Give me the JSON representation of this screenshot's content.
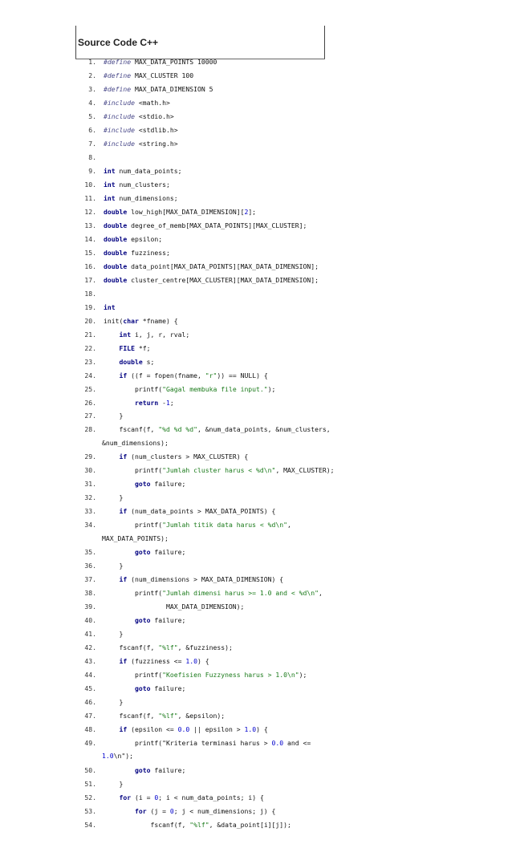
{
  "document": {
    "title": "Source Code C++",
    "lines": [
      {
        "n": "1",
        "t": "#define MAX_DATA_POINTS 10000"
      },
      {
        "n": "2",
        "t": "#define MAX_CLUSTER 100"
      },
      {
        "n": "3",
        "t": "#define MAX_DATA_DIMENSION 5"
      },
      {
        "n": "4",
        "t": "#include <math.h>"
      },
      {
        "n": "5",
        "t": "#include <stdio.h>"
      },
      {
        "n": "6",
        "t": "#include <stdlib.h>"
      },
      {
        "n": "7",
        "t": "#include <string.h>"
      },
      {
        "n": "8",
        "t": ""
      },
      {
        "n": "9",
        "t": "int num_data_points;"
      },
      {
        "n": "10",
        "t": "int num_clusters;"
      },
      {
        "n": "11",
        "t": "int num_dimensions;"
      },
      {
        "n": "12",
        "t": "double low_high[MAX_DATA_DIMENSION][2];"
      },
      {
        "n": "13",
        "t": "double degree_of_memb[MAX_DATA_POINTS][MAX_CLUSTER];"
      },
      {
        "n": "14",
        "t": "double epsilon;"
      },
      {
        "n": "15",
        "t": "double fuzziness;"
      },
      {
        "n": "16",
        "t": "double data_point[MAX_DATA_POINTS][MAX_DATA_DIMENSION];"
      },
      {
        "n": "17",
        "t": "double cluster_centre[MAX_CLUSTER][MAX_DATA_DIMENSION];"
      },
      {
        "n": "18",
        "t": ""
      },
      {
        "n": "19",
        "t": "int"
      },
      {
        "n": "20",
        "t": "init(char *fname) {"
      },
      {
        "n": "21",
        "t": "    int i, j, r, rval;"
      },
      {
        "n": "22",
        "t": "    FILE *f;"
      },
      {
        "n": "23",
        "t": "    double s;"
      },
      {
        "n": "24",
        "t": "    if ((f = fopen(fname, \"r\")) == NULL) {"
      },
      {
        "n": "25",
        "t": "        printf(\"Gagal membuka file input.\");"
      },
      {
        "n": "26",
        "t": "        return -1;"
      },
      {
        "n": "27",
        "t": "    }"
      },
      {
        "n": "28",
        "t": "    fscanf(f, \"%d %d %d\", &num_data_points, &num_clusters,",
        "c": "&num_dimensions);"
      },
      {
        "n": "29",
        "t": "    if (num_clusters > MAX_CLUSTER) {"
      },
      {
        "n": "30",
        "t": "        printf(\"Jumlah cluster harus < %d\\n\", MAX_CLUSTER);"
      },
      {
        "n": "31",
        "t": "        goto failure;"
      },
      {
        "n": "32",
        "t": "    }"
      },
      {
        "n": "33",
        "t": "    if (num_data_points > MAX_DATA_POINTS) {"
      },
      {
        "n": "34",
        "t": "        printf(\"Jumlah titik data harus < %d\\n\",",
        "c": "MAX_DATA_POINTS);"
      },
      {
        "n": "35",
        "t": "        goto failure;"
      },
      {
        "n": "36",
        "t": "    }"
      },
      {
        "n": "37",
        "t": "    if (num_dimensions > MAX_DATA_DIMENSION) {"
      },
      {
        "n": "38",
        "t": "        printf(\"Jumlah dimensi harus >= 1.0 and < %d\\n\","
      },
      {
        "n": "39",
        "t": "                MAX_DATA_DIMENSION);"
      },
      {
        "n": "40",
        "t": "        goto failure;"
      },
      {
        "n": "41",
        "t": "    }"
      },
      {
        "n": "42",
        "t": "    fscanf(f, \"%lf\", &fuzziness);"
      },
      {
        "n": "43",
        "t": "    if (fuzziness <= 1.0) {"
      },
      {
        "n": "44",
        "t": "        printf(\"Koefisien Fuzzyness harus > 1.0\\n\");"
      },
      {
        "n": "45",
        "t": "        goto failure;"
      },
      {
        "n": "46",
        "t": "    }"
      },
      {
        "n": "47",
        "t": "    fscanf(f, \"%lf\", &epsilon);"
      },
      {
        "n": "48",
        "t": "    if (epsilon <= 0.0 || epsilon > 1.0) {"
      },
      {
        "n": "49",
        "t": "        printf(\"Kriteria terminasi harus > 0.0 and <=",
        "c": "1.0\\n\");"
      },
      {
        "n": "50",
        "t": "        goto failure;"
      },
      {
        "n": "51",
        "t": "    }"
      },
      {
        "n": "52",
        "t": "    for (i = 0; i < num_data_points; i) {"
      },
      {
        "n": "53",
        "t": "        for (j = 0; j < num_dimensions; j) {"
      },
      {
        "n": "54",
        "t": "            fscanf(f, \"%lf\", &data_point[i][j]);"
      }
    ]
  }
}
